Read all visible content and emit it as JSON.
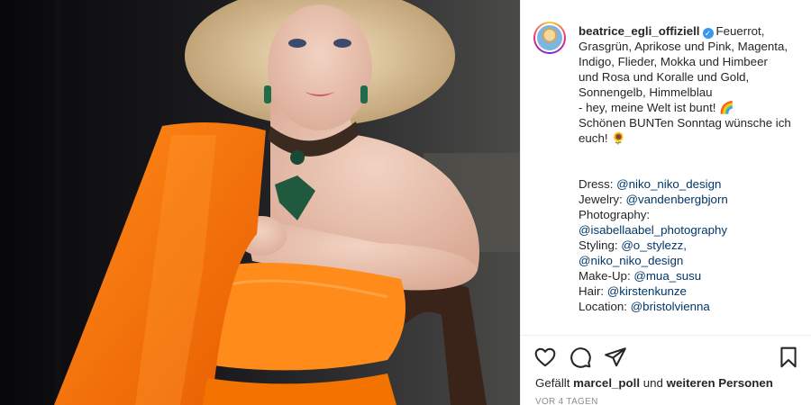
{
  "post": {
    "username": "beatrice_egli_offiziell",
    "caption_text": "Feuerrot, Grasgrün, Aprikose und Pink, Magenta, Indigo, Flieder, Mokka und Himbeer\nund Rosa und Koralle und Gold, Sonnengelb, Himmelblau\n- hey, meine Welt ist bunt! 🌈\nSchönen BUNTen Sonntag wünsche ich euch! 🌻",
    "credits": [
      {
        "label": "Dress: ",
        "tag": "@niko_niko_design"
      },
      {
        "label": "Jewelry: ",
        "tag": "@vandenbergbjorn"
      },
      {
        "label": "Photography: ",
        "tag": "@isabellaabel_photography"
      },
      {
        "label": "Styling: ",
        "tag": "@o_stylezz,"
      },
      {
        "label": "",
        "tag": "@niko_niko_design"
      },
      {
        "label": "Make-Up: ",
        "tag": "@mua_susu"
      },
      {
        "label": "Hair: ",
        "tag": "@kirstenkunze"
      },
      {
        "label": "Location: ",
        "tag": "@bristolvienna"
      }
    ]
  },
  "likes": {
    "prefix": "Gefällt",
    "user": "marcel_poll",
    "middle": "und",
    "suffix": "weiteren Personen"
  },
  "timestamp": "VOR 4 TAGEN",
  "icons": {
    "like": "heart-icon",
    "comment": "comment-icon",
    "share": "share-icon",
    "save": "bookmark-icon",
    "verified": "verified-badge-icon"
  },
  "colors": {
    "link": "#00376b",
    "verified": "#3897f0",
    "text": "#262626",
    "muted": "#8e8e8e",
    "outfit": "#ff7a00"
  }
}
